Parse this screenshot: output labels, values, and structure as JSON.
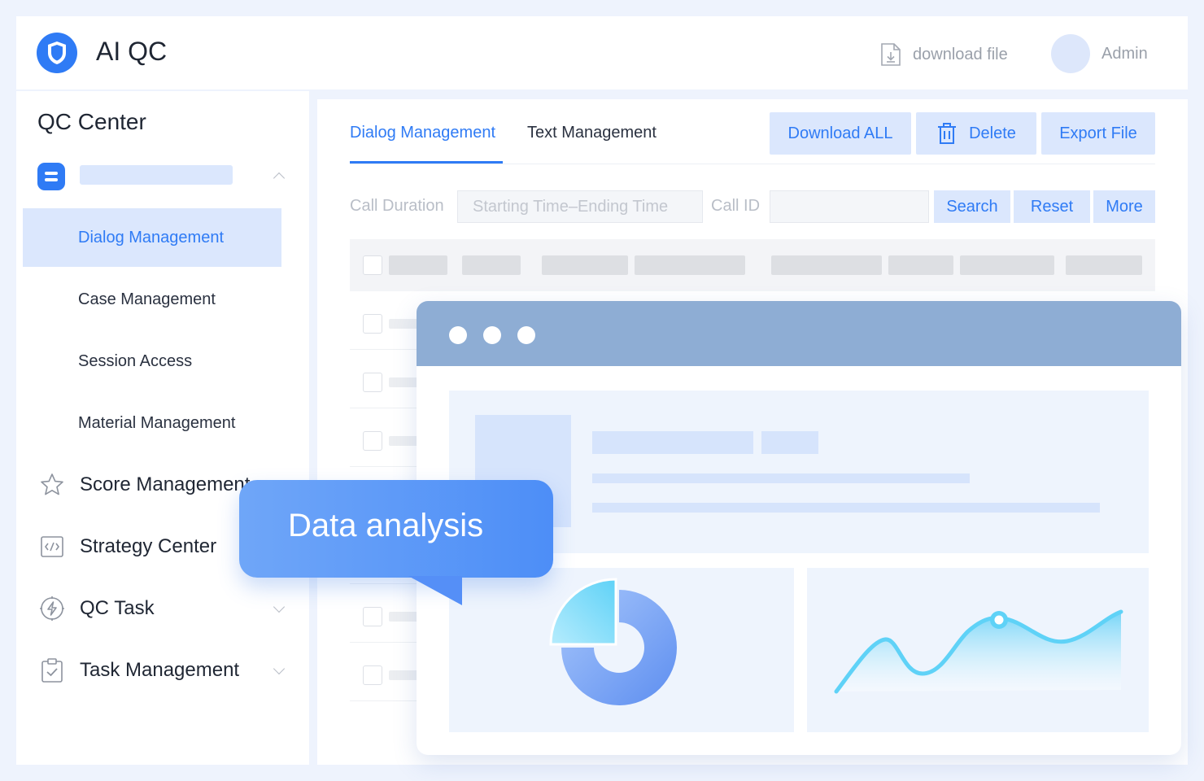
{
  "header": {
    "app_title": "AI QC",
    "download_label": "download file",
    "user_name": "Admin"
  },
  "sidebar": {
    "section_title": "QC Center",
    "sub_items": [
      {
        "label": "Dialog Management",
        "active": true
      },
      {
        "label": "Case Management",
        "active": false
      },
      {
        "label": "Session Access",
        "active": false
      },
      {
        "label": "Material Management",
        "active": false
      }
    ],
    "main_items": [
      {
        "label": "Score Management",
        "icon": "star-icon"
      },
      {
        "label": "Strategy Center",
        "icon": "code-icon"
      },
      {
        "label": "QC Task",
        "icon": "lightning-icon"
      },
      {
        "label": "Task Management",
        "icon": "clipboard-check-icon"
      }
    ]
  },
  "content": {
    "tabs": [
      {
        "label": "Dialog Management",
        "active": true
      },
      {
        "label": "Text Management",
        "active": false
      }
    ],
    "actions": {
      "download_all": "Download ALL",
      "delete": "Delete",
      "export": "Export File"
    },
    "filters": {
      "duration_label": "Call Duration",
      "duration_placeholder": "Starting Time–Ending Time",
      "call_id_label": "Call ID",
      "search": "Search",
      "reset": "Reset",
      "more": "More"
    }
  },
  "overlay": {
    "callout": "Data analysis"
  },
  "colors": {
    "accent": "#2f7bf5",
    "accent_light": "#dbe7fd",
    "window_bar": "#8eadd4"
  }
}
